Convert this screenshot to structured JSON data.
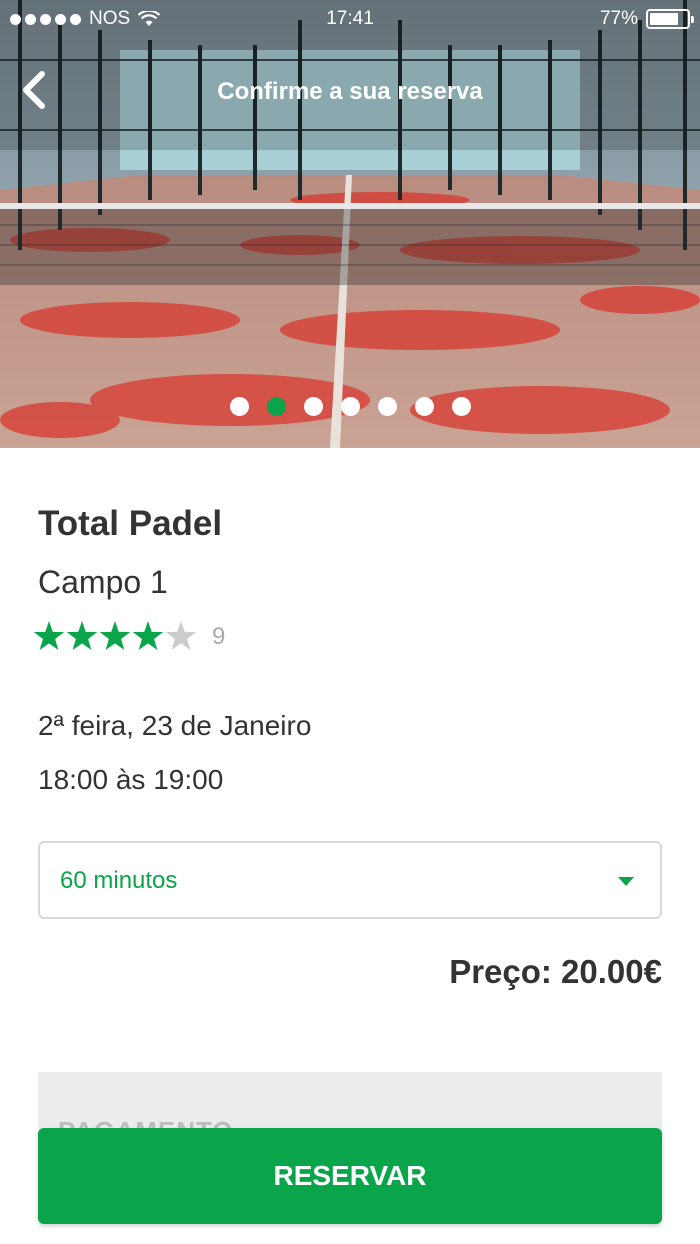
{
  "status_bar": {
    "carrier": "NOS",
    "time": "17:41",
    "battery": "77%",
    "battery_level": 0.77
  },
  "header": {
    "title": "Confirme a sua reserva"
  },
  "carousel": {
    "count": 7,
    "active_index": 1
  },
  "venue": {
    "name": "Total Padel",
    "court": "Campo 1"
  },
  "rating": {
    "stars": 4,
    "max": 5,
    "count": "9"
  },
  "booking": {
    "date": "2ª feira, 23 de Janeiro",
    "time": "18:00 às 19:00"
  },
  "duration": {
    "selected": "60 minutos"
  },
  "price": {
    "label": "Preço: 20.00€"
  },
  "payment": {
    "label": "PAGAMENTO"
  },
  "actions": {
    "reserve_label": "RESERVAR"
  },
  "colors": {
    "accent": "#0aa54a",
    "text": "#333333",
    "muted": "#aaaaaa"
  }
}
